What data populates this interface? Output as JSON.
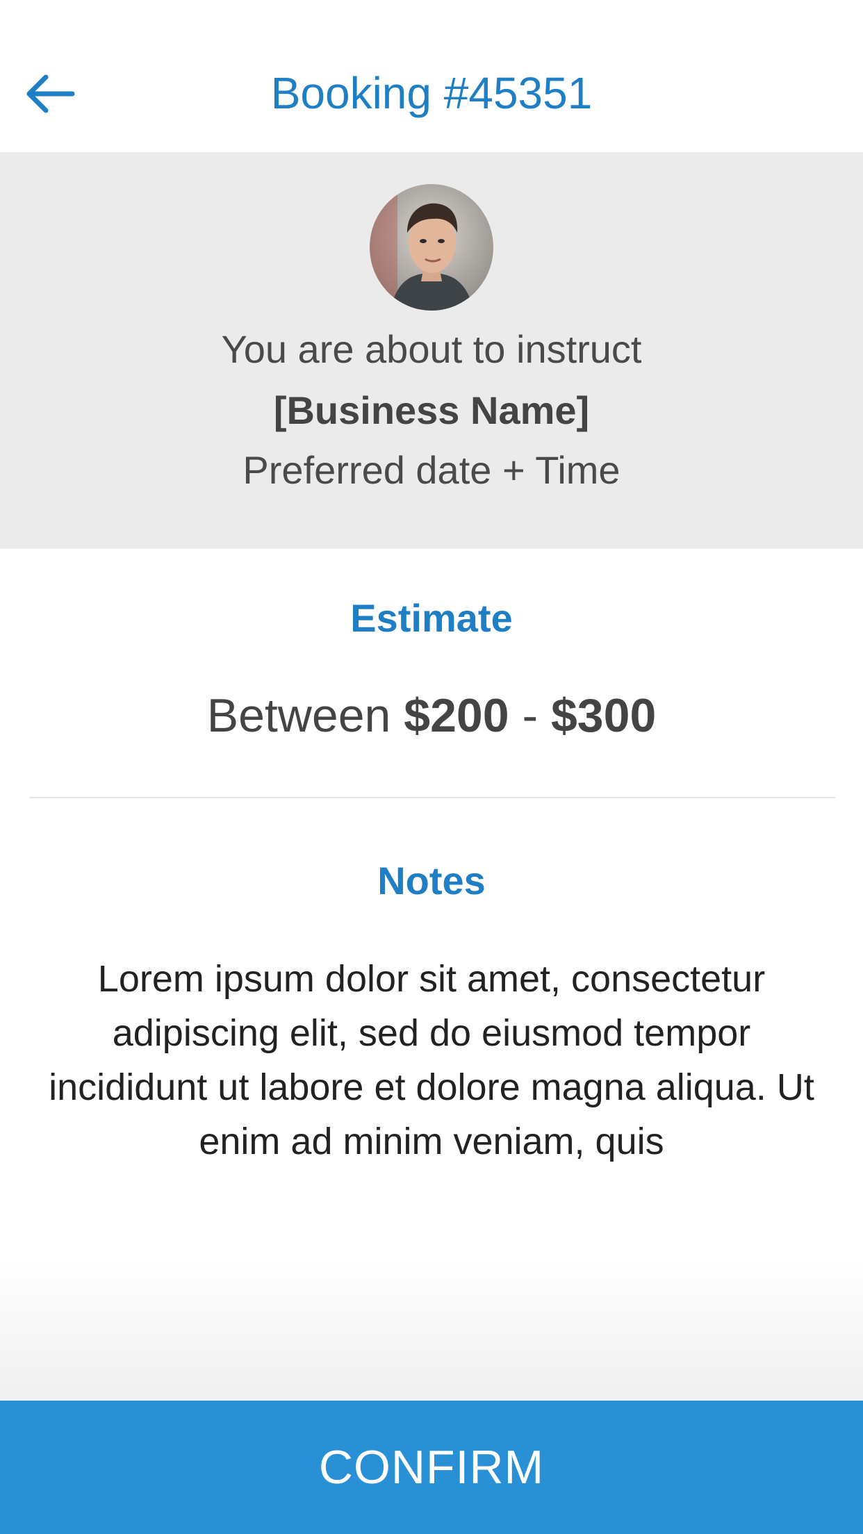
{
  "header": {
    "back_icon": "arrow-left-icon",
    "title": "Booking #45351"
  },
  "summary": {
    "avatar": "person-avatar",
    "line1": "You are about to instruct",
    "business_name": "[Business Name]",
    "date_time": "Preferred date + Time"
  },
  "estimate": {
    "heading": "Estimate",
    "prefix": "Between ",
    "low": "$200",
    "separator": " - ",
    "high": "$300"
  },
  "notes": {
    "heading": "Notes",
    "body": "Lorem ipsum dolor sit amet, consectetur adipiscing elit, sed do eiusmod tempor incididunt ut labore et dolore magna aliqua. Ut enim ad minim veniam, quis"
  },
  "confirm": {
    "label": "CONFIRM"
  },
  "colors": {
    "accent": "#1f7fc4",
    "confirm_bg": "#2990d6",
    "summary_bg": "#ebebeb",
    "text": "#444444"
  }
}
